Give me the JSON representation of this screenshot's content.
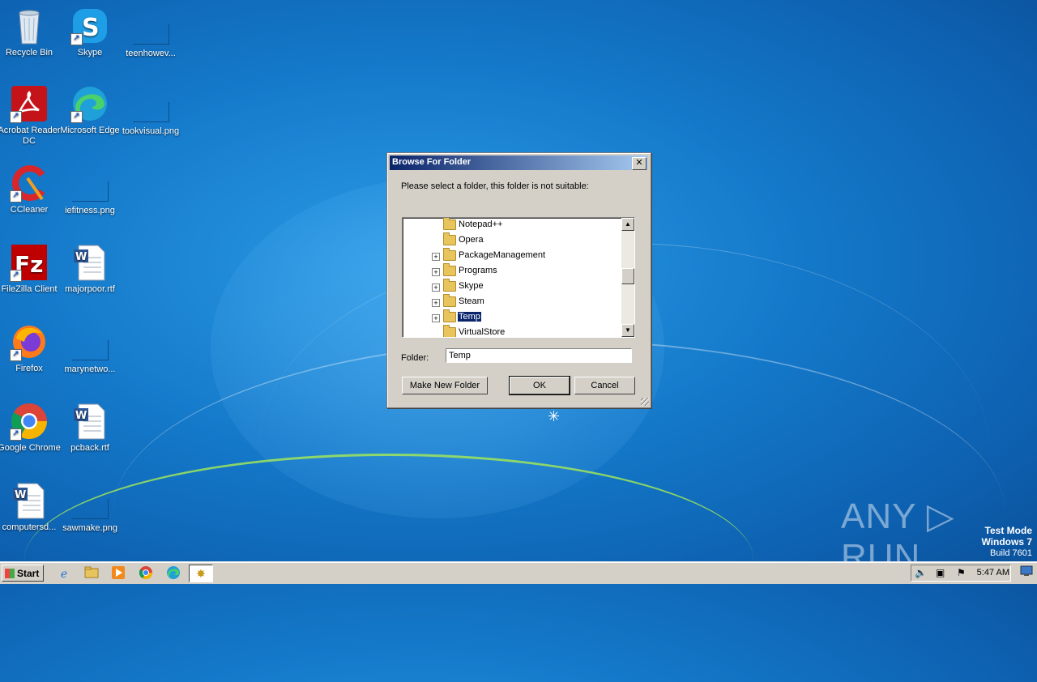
{
  "desktop": {
    "icons": [
      {
        "label": "Recycle Bin",
        "icon": "recycle-bin-icon"
      },
      {
        "label": "Skype",
        "icon": "skype-icon"
      },
      {
        "label": "teenhowev...",
        "icon": "file-icon"
      },
      {
        "label": "Acrobat Reader DC",
        "icon": "acrobat-icon"
      },
      {
        "label": "Microsoft Edge",
        "icon": "edge-icon"
      },
      {
        "label": "tookvisual.png",
        "icon": "file-icon"
      },
      {
        "label": "CCleaner",
        "icon": "ccleaner-icon"
      },
      {
        "label": "iefitness.png",
        "icon": "file-icon"
      },
      {
        "label": "FileZilla Client",
        "icon": "filezilla-icon"
      },
      {
        "label": "majorpoor.rtf",
        "icon": "word-doc-icon"
      },
      {
        "label": "Firefox",
        "icon": "firefox-icon"
      },
      {
        "label": "marynetwo...",
        "icon": "file-icon"
      },
      {
        "label": "Google Chrome",
        "icon": "chrome-icon"
      },
      {
        "label": "pcback.rtf",
        "icon": "word-doc-icon"
      },
      {
        "label": "computersd...",
        "icon": "word-doc-icon"
      },
      {
        "label": "sawmake.png",
        "icon": "file-icon"
      }
    ]
  },
  "dialog": {
    "title": "Browse For Folder",
    "close_label": "✕",
    "prompt": "Please select a folder, this folder is not suitable:",
    "tree_items": [
      {
        "name": "Notepad++",
        "expandable": false,
        "selected": false
      },
      {
        "name": "Opera",
        "expandable": false,
        "selected": false
      },
      {
        "name": "PackageManagement",
        "expandable": true,
        "selected": false
      },
      {
        "name": "Programs",
        "expandable": true,
        "selected": false
      },
      {
        "name": "Skype",
        "expandable": true,
        "selected": false
      },
      {
        "name": "Steam",
        "expandable": true,
        "selected": false
      },
      {
        "name": "Temp",
        "expandable": true,
        "selected": true
      },
      {
        "name": "VirtualStore",
        "expandable": false,
        "selected": false
      }
    ],
    "expander_glyph": "+",
    "scroll_up": "▲",
    "scroll_down": "▼",
    "folder_label": "Folder:",
    "folder_value": "Temp",
    "make_new_folder_label": "Make New Folder",
    "ok_label": "OK",
    "cancel_label": "Cancel"
  },
  "watermark": {
    "brand": "ANY ▷ RUN",
    "test_mode": "Test Mode",
    "os": "Windows 7",
    "build": "Build 7601"
  },
  "taskbar": {
    "start_label": "Start",
    "clock": "5:47 AM",
    "pinned": [
      "internet-explorer-icon",
      "file-explorer-icon",
      "media-player-icon",
      "chrome-icon",
      "edge-icon",
      "active-app-icon"
    ]
  }
}
